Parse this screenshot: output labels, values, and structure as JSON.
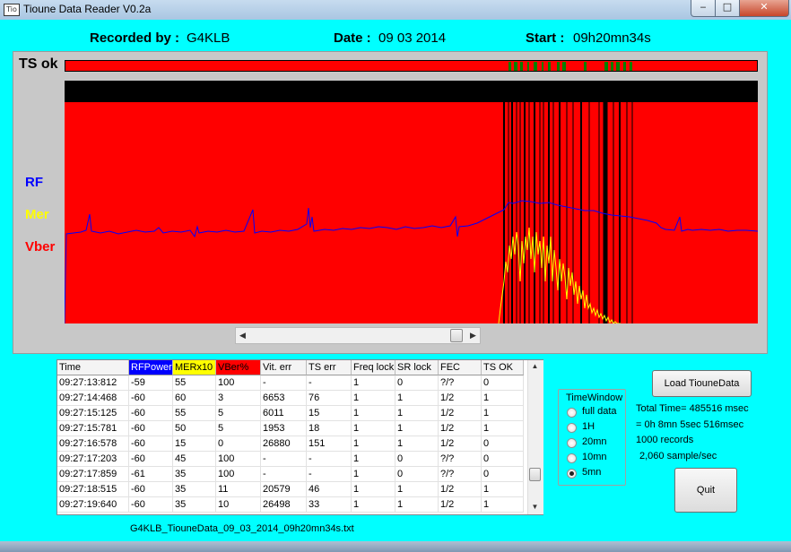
{
  "window": {
    "title": "Tioune Data Reader V0.2a",
    "icon_label": "Tio"
  },
  "controls": {
    "minimize": "‒",
    "maximize": "□",
    "close": "✕"
  },
  "header": {
    "recorded_label": "Recorded by :",
    "recorded_value": "G4KLB",
    "date_label": "Date :",
    "date_value": "09 03 2014",
    "start_label": "Start :",
    "start_value": "09h20mn34s"
  },
  "plot": {
    "ts_label": "TS ok",
    "legend": {
      "rf": "RF",
      "mer": "Mer",
      "vber": "Vber"
    },
    "colors": {
      "rf": "#0000ff",
      "mer": "#ffff00",
      "vber": "#ff0000",
      "ts_ok": "#008000",
      "ts_fail": "#ff0000"
    }
  },
  "grid": {
    "columns": [
      "Time",
      "RFPower",
      "MERx10",
      "VBer%",
      "Vit. err",
      "TS err",
      "Freq lock",
      "SR lock",
      "FEC",
      "TS OK"
    ],
    "header_colors": {
      "RFPower": "#0000ff",
      "MERx10": "#ffff00",
      "VBer%": "#ff0000"
    },
    "rows": [
      [
        "09:27:13:812",
        "-59",
        "55",
        "100",
        "-",
        "-",
        "1",
        "0",
        "?/?",
        "0"
      ],
      [
        "09:27:14:468",
        "-60",
        "60",
        "3",
        "6653",
        "76",
        "1",
        "1",
        "1/2",
        "1"
      ],
      [
        "09:27:15:125",
        "-60",
        "55",
        "5",
        "6011",
        "15",
        "1",
        "1",
        "1/2",
        "1"
      ],
      [
        "09:27:15:781",
        "-60",
        "50",
        "5",
        "1953",
        "18",
        "1",
        "1",
        "1/2",
        "1"
      ],
      [
        "09:27:16:578",
        "-60",
        "15",
        "0",
        "26880",
        "151",
        "1",
        "1",
        "1/2",
        "0"
      ],
      [
        "09:27:17:203",
        "-60",
        "45",
        "100",
        "-",
        "-",
        "1",
        "0",
        "?/?",
        "0"
      ],
      [
        "09:27:17:859",
        "-61",
        "35",
        "100",
        "-",
        "-",
        "1",
        "0",
        "?/?",
        "0"
      ],
      [
        "09:27:18:515",
        "-60",
        "35",
        "11",
        "20579",
        "46",
        "1",
        "1",
        "1/2",
        "1"
      ],
      [
        "09:27:19:640",
        "-60",
        "35",
        "10",
        "26498",
        "33",
        "1",
        "1",
        "1/2",
        "1"
      ]
    ]
  },
  "filename": "G4KLB_TiouneData_09_03_2014_09h20mn34s.txt",
  "time_window": {
    "label": "TimeWindow",
    "options": [
      "full data",
      "1H",
      "20mn",
      "10mn",
      "5mn"
    ],
    "selected": "5mn"
  },
  "buttons": {
    "load": "Load TiouneData",
    "quit": "Quit"
  },
  "info": {
    "total_time": "Total Time= 485516 msec",
    "duration": "= 0h 8mn 5sec 516msec",
    "records": "1000 records",
    "rate": "2,060 sample/sec"
  }
}
